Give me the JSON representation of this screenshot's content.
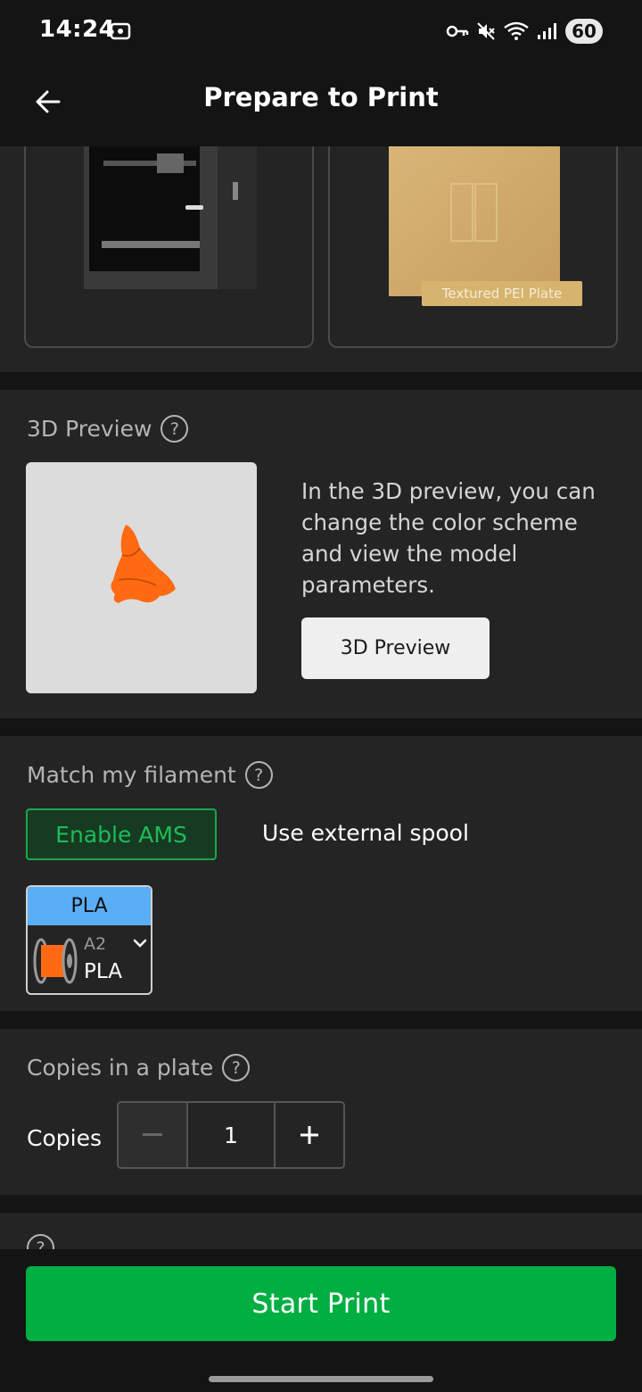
{
  "status": {
    "time": "14:24",
    "battery": "60"
  },
  "header": {
    "title": "Prepare to Print"
  },
  "plate": {
    "label": "Textured PEI Plate"
  },
  "preview": {
    "section_title": "3D Preview",
    "description": "In the 3D preview, you can change the color scheme and view the model parameters.",
    "button_label": "3D Preview",
    "model_color": "#ff6a13"
  },
  "filament": {
    "section_title": "Match my filament",
    "ams_label": "Enable AMS",
    "external_label": "Use external spool",
    "slot": {
      "header": "PLA",
      "header_color": "#5aaef7",
      "slot_id": "A2",
      "type": "PLA",
      "color": "#ff6a13"
    }
  },
  "copies": {
    "section_title": "Copies in a plate",
    "label": "Copies",
    "value": "1"
  },
  "actions": {
    "start_label": "Start Print",
    "start_color": "#00ae42"
  }
}
